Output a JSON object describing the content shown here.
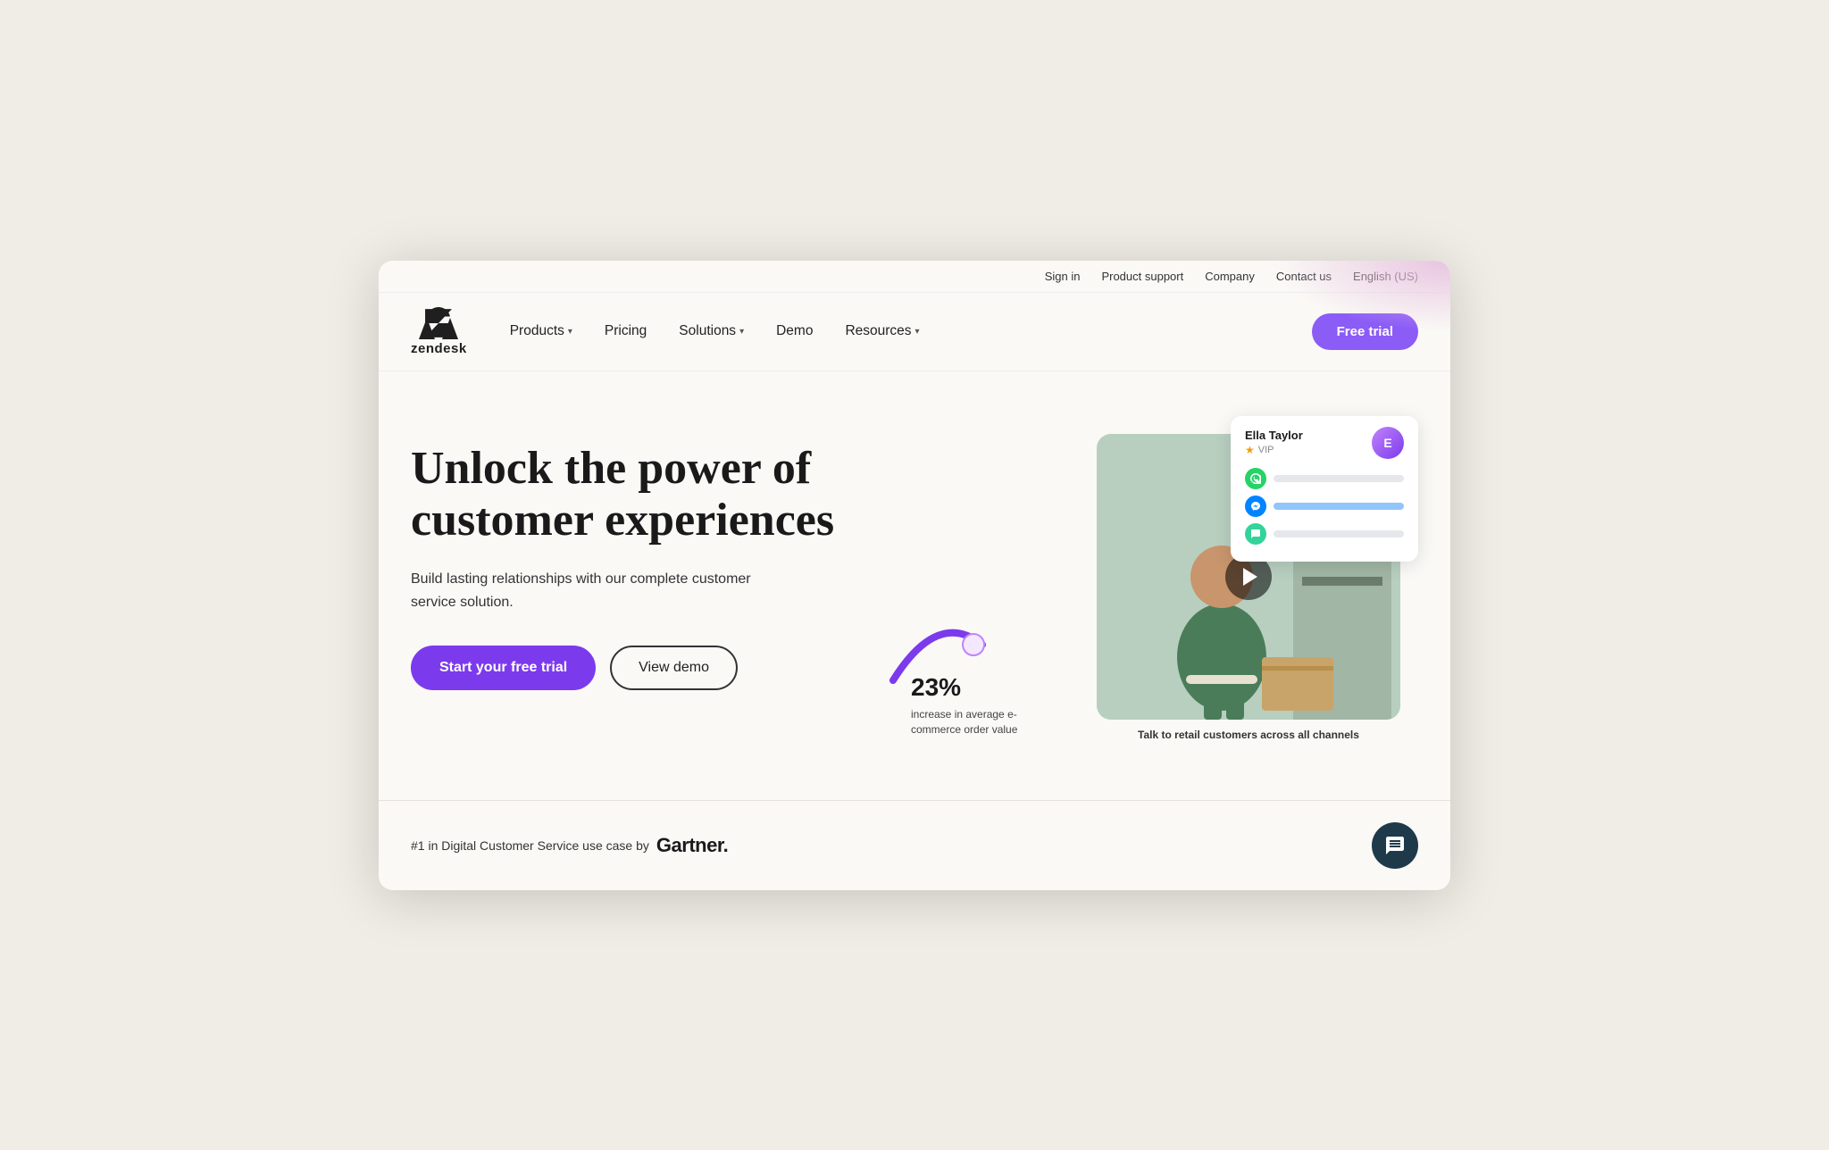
{
  "utility": {
    "sign_in": "Sign in",
    "product_support": "Product support",
    "company": "Company",
    "contact_us": "Contact us",
    "language": "English (US)"
  },
  "nav": {
    "logo_text": "zendesk",
    "links": [
      {
        "label": "Products",
        "has_dropdown": true
      },
      {
        "label": "Pricing",
        "has_dropdown": false
      },
      {
        "label": "Solutions",
        "has_dropdown": true
      },
      {
        "label": "Demo",
        "has_dropdown": false
      },
      {
        "label": "Resources",
        "has_dropdown": true
      }
    ],
    "cta": "Free trial"
  },
  "hero": {
    "title": "Unlock the power of customer experiences",
    "subtitle": "Build lasting relationships with our complete customer service solution.",
    "primary_btn": "Start your free trial",
    "secondary_btn": "View demo"
  },
  "stat": {
    "number": "23",
    "unit": "%",
    "label": "increase in average e-commerce order value"
  },
  "customer_card": {
    "name": "Ella Taylor",
    "vip_label": "VIP",
    "avatar_initials": "E"
  },
  "image_caption": "Talk to retail customers across all channels",
  "bottom": {
    "prefix": "#1 in Digital Customer Service use case by",
    "brand": "Gartner."
  }
}
